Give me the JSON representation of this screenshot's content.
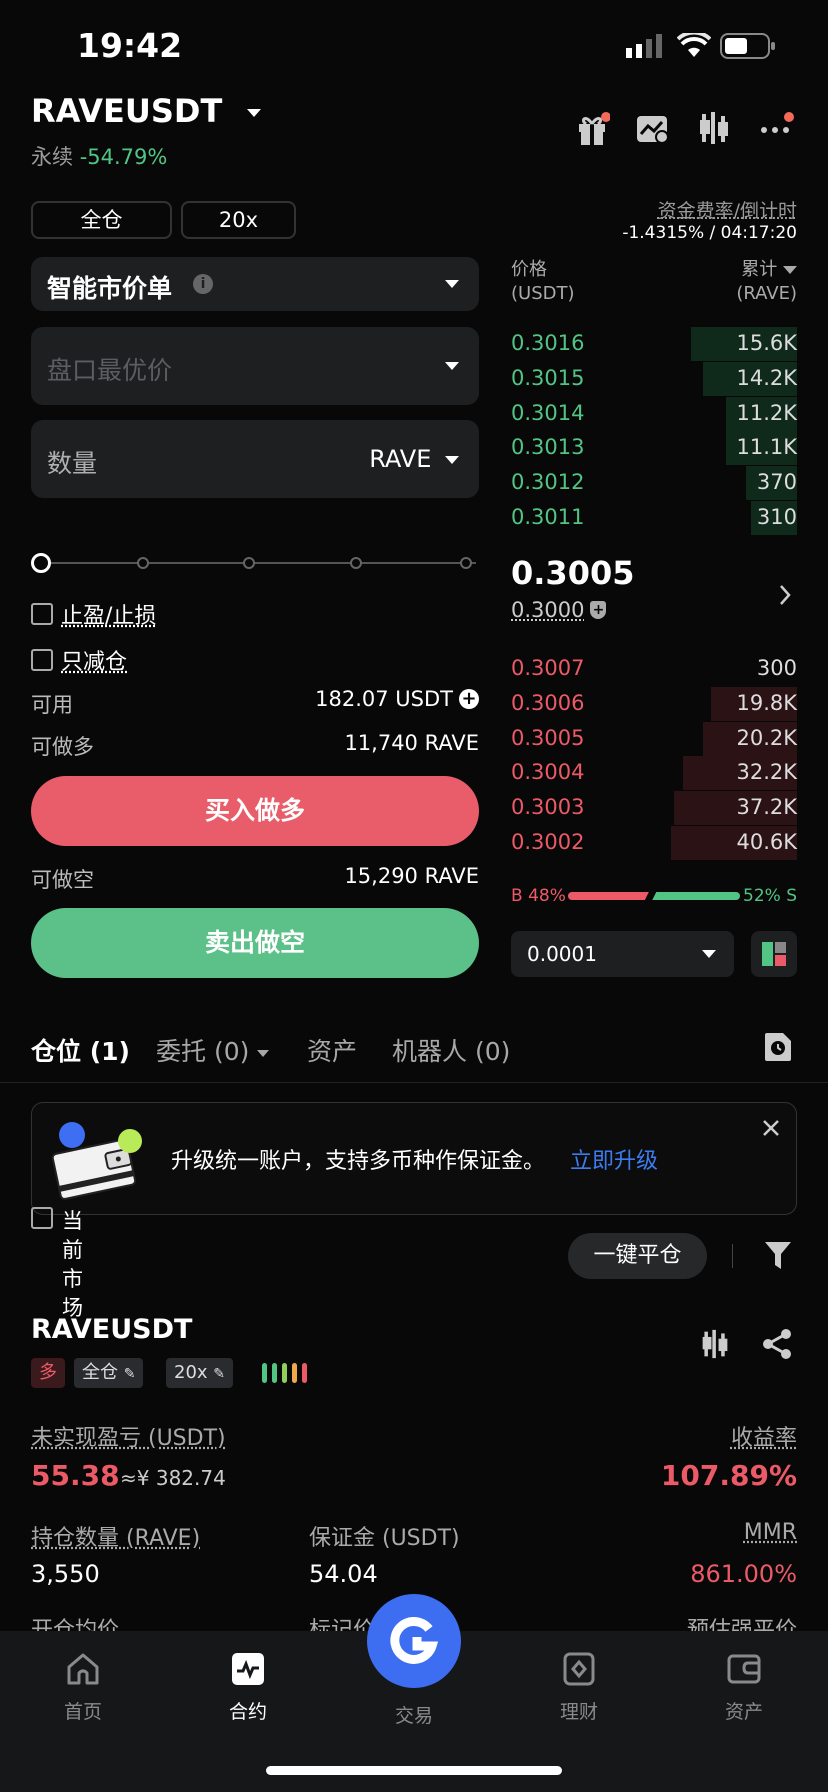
{
  "status_bar": {
    "time": "19:42"
  },
  "header": {
    "symbol": "RAVEUSDT",
    "subtitle": "永续",
    "change": "-54.79%",
    "icons": [
      "gift-icon",
      "chart-check-icon",
      "candlestick-icon",
      "more-icon"
    ]
  },
  "margin": {
    "mode": "全仓",
    "leverage": "20x"
  },
  "funding": {
    "label": "资金费率/倒计时",
    "value": "-1.4315% / 04:17:20"
  },
  "order_form": {
    "type": "智能市价单",
    "price_placeholder": "盘口最优价",
    "qty_placeholder": "数量",
    "qty_unit": "RAVE",
    "slider_percent": 0,
    "tp_sl": "止盈/止损",
    "reduce_only": "只减仓",
    "available_label": "可用",
    "available_value": "182.07 USDT",
    "max_long_label": "可做多",
    "max_long_value": "11,740 RAVE",
    "buy_button": "买入做多",
    "max_short_label": "可做空",
    "max_short_value": "15,290 RAVE",
    "sell_button": "卖出做空"
  },
  "orderbook": {
    "price_header": "价格",
    "price_unit": "(USDT)",
    "qty_header": "累计",
    "qty_unit": "(RAVE)",
    "asks": [
      {
        "price": "0.3016",
        "qty": "15.6K",
        "depth": 0.37
      },
      {
        "price": "0.3015",
        "qty": "14.2K",
        "depth": 0.33
      },
      {
        "price": "0.3014",
        "qty": "11.2K",
        "depth": 0.25
      },
      {
        "price": "0.3013",
        "qty": "11.1K",
        "depth": 0.25
      },
      {
        "price": "0.3012",
        "qty": "370",
        "depth": 0.18
      },
      {
        "price": "0.3011",
        "qty": "310",
        "depth": 0.16
      }
    ],
    "last_price": "0.3005",
    "mark_price": "0.3000",
    "bids": [
      {
        "price": "0.3007",
        "qty": "300",
        "depth": 0.0
      },
      {
        "price": "0.3006",
        "qty": "19.8K",
        "depth": 0.3
      },
      {
        "price": "0.3005",
        "qty": "20.2K",
        "depth": 0.33
      },
      {
        "price": "0.3004",
        "qty": "32.2K",
        "depth": 0.4
      },
      {
        "price": "0.3003",
        "qty": "37.2K",
        "depth": 0.43
      },
      {
        "price": "0.3002",
        "qty": "40.6K",
        "depth": 0.44
      }
    ],
    "buy_ratio": "B 48%",
    "sell_ratio": "52% S",
    "buy_ratio_value": 0.48,
    "precision": "0.0001"
  },
  "tabs": [
    {
      "label": "仓位 (1)"
    },
    {
      "label": "委托 (0)"
    },
    {
      "label": "资产"
    },
    {
      "label": "机器人 (0)"
    }
  ],
  "banner": {
    "text": "升级统一账户，支持多币种作保证金。",
    "link": "立即升级"
  },
  "filter": {
    "current_market": "当前市场",
    "close_all": "一键平仓"
  },
  "position": {
    "symbol": "RAVEUSDT",
    "side": "多",
    "mode": "全仓",
    "leverage": "20x",
    "pnl_label": "未实现盈亏 (USDT)",
    "pnl_value": "55.38",
    "pnl_cny": "≈¥ 382.74",
    "roe_label": "收益率",
    "roe_value": "107.89%",
    "size_label": "持仓数量 (RAVE)",
    "size_value": "3,550",
    "margin_label": "保证金 (USDT)",
    "margin_value": "54.04",
    "mmr_label": "MMR",
    "mmr_value": "861.00%",
    "entry_label": "开仓均价",
    "mark_label": "标记价",
    "liq_label": "预估强平价"
  },
  "nav": [
    {
      "label": "首页"
    },
    {
      "label": "合约"
    },
    {
      "label": "交易"
    },
    {
      "label": "理财"
    },
    {
      "label": "资产"
    }
  ],
  "colors": {
    "green": "#52c585",
    "red": "#ec5a67",
    "link": "#3d7cf0",
    "accent": "#3d6ef2"
  }
}
